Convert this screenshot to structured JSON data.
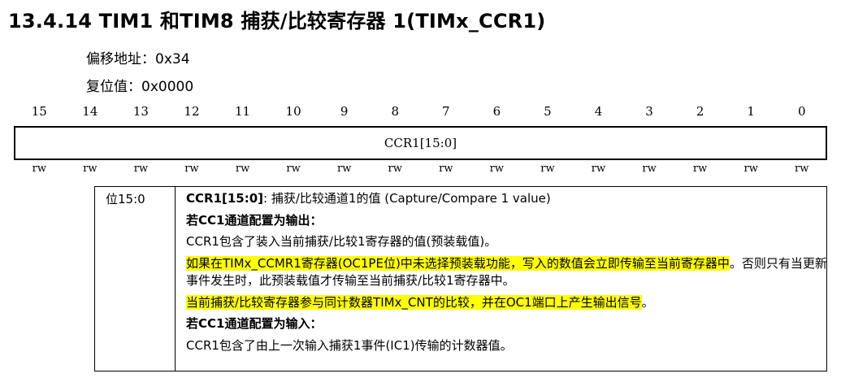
{
  "header": {
    "title": "13.4.14 TIM1 和TIM8 捕获/比较寄存器 1(TIMx_CCR1)",
    "offset": "偏移地址：0x34",
    "reset": "复位值：0x0000"
  },
  "register": {
    "bits": [
      "15",
      "14",
      "13",
      "12",
      "11",
      "10",
      "9",
      "8",
      "7",
      "6",
      "5",
      "4",
      "3",
      "2",
      "1",
      "0"
    ],
    "field": "CCR1[15:0]",
    "access": [
      "rw",
      "rw",
      "rw",
      "rw",
      "rw",
      "rw",
      "rw",
      "rw",
      "rw",
      "rw",
      "rw",
      "rw",
      "rw",
      "rw",
      "rw",
      "rw"
    ]
  },
  "description": {
    "bits_label": "位15:0",
    "field_name": "CCR1[15:0]",
    "field_desc": ": 捕获/比较通道1的值 (Capture/Compare 1 value)",
    "output_heading_pre": "若",
    "output_heading_b": "CC1",
    "output_heading_post": "通道配置为输出：",
    "output_line1": "CCR1包含了装入当前捕获/比较1寄存器的值(预装载值)。",
    "output_line2_hl": "如果在TIMx_CCMR1寄存器(OC1PE位)中未选择预装载功能，写入的数值会立即传输至当前寄存器中",
    "output_line2_rest": "。否则只有当更新事件发生时，此预装载值才传输至当前捕获/比较1寄存器中。",
    "output_line3_hl": "当前捕获/比较寄存器参与同计数器TIMx_CNT的比较，并在OC1端口上产生输出信号",
    "output_line3_rest": "。",
    "input_heading_pre": "若",
    "input_heading_b": "CC1",
    "input_heading_post": "通道配置为输入：",
    "input_line1": "CCR1包含了由上一次输入捕获1事件(IC1)传输的计数器值。"
  }
}
